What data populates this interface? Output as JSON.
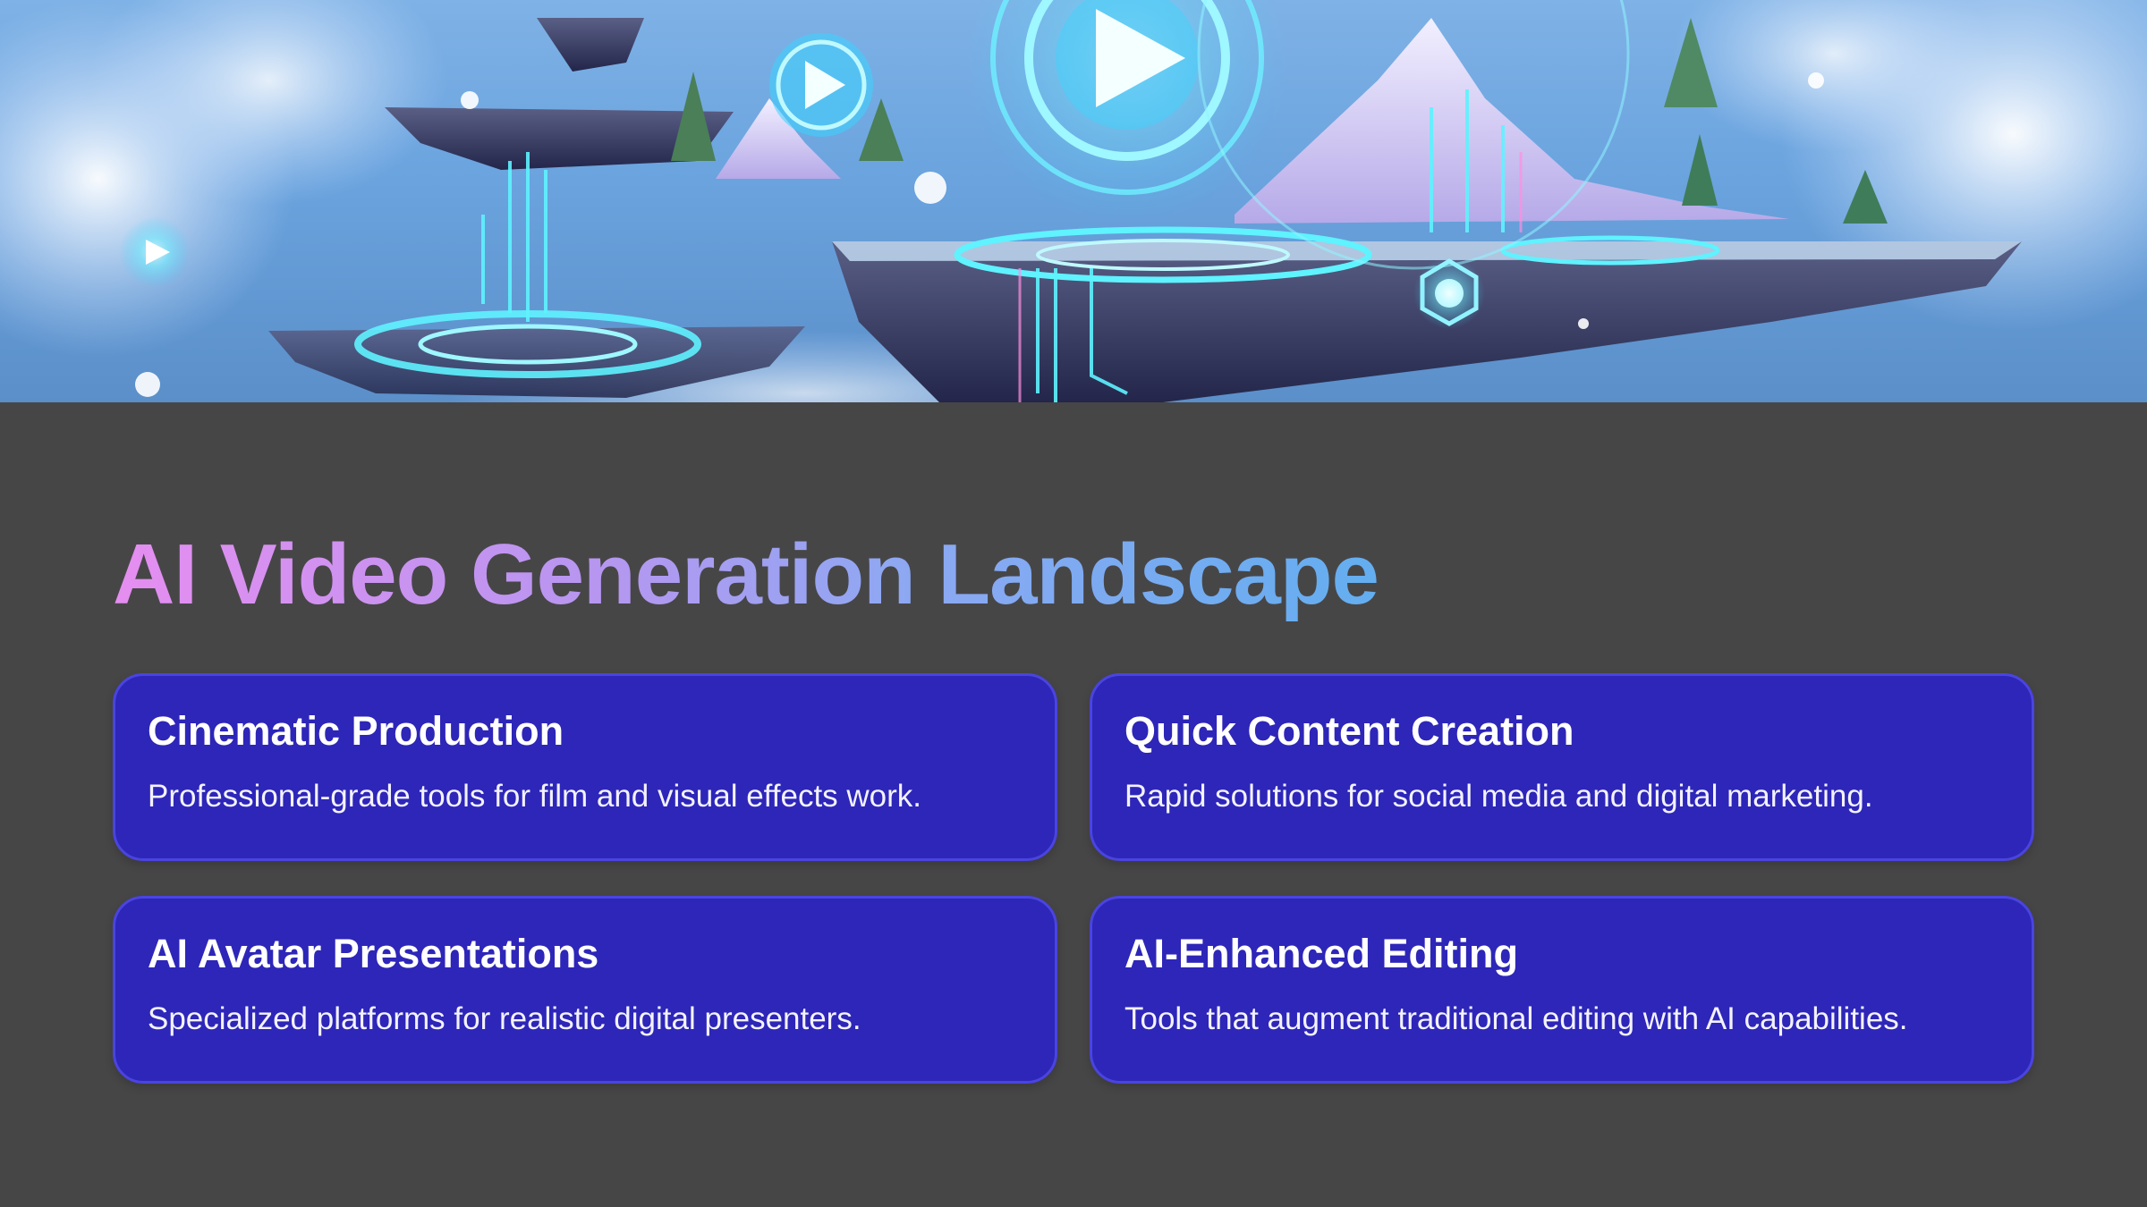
{
  "slide": {
    "title": "AI Video Generation Landscape"
  },
  "hero_image": {
    "description_icon": "floating-islands-play-icon"
  },
  "cards": [
    {
      "title": "Cinematic Production",
      "description": "Professional-grade tools for film and visual effects work."
    },
    {
      "title": "Quick Content Creation",
      "description": "Rapid solutions for social media and digital marketing."
    },
    {
      "title": "AI Avatar Presentations",
      "description": "Specialized platforms for realistic digital presenters."
    },
    {
      "title": "AI-Enhanced Editing",
      "description": "Tools that augment traditional editing with AI capabilities."
    }
  ],
  "colors": {
    "background": "#474647",
    "card": "#2d26b8",
    "card_border": "#4a44e0",
    "title_gradient_start": "#e58ef0",
    "title_gradient_end": "#63aef0"
  }
}
